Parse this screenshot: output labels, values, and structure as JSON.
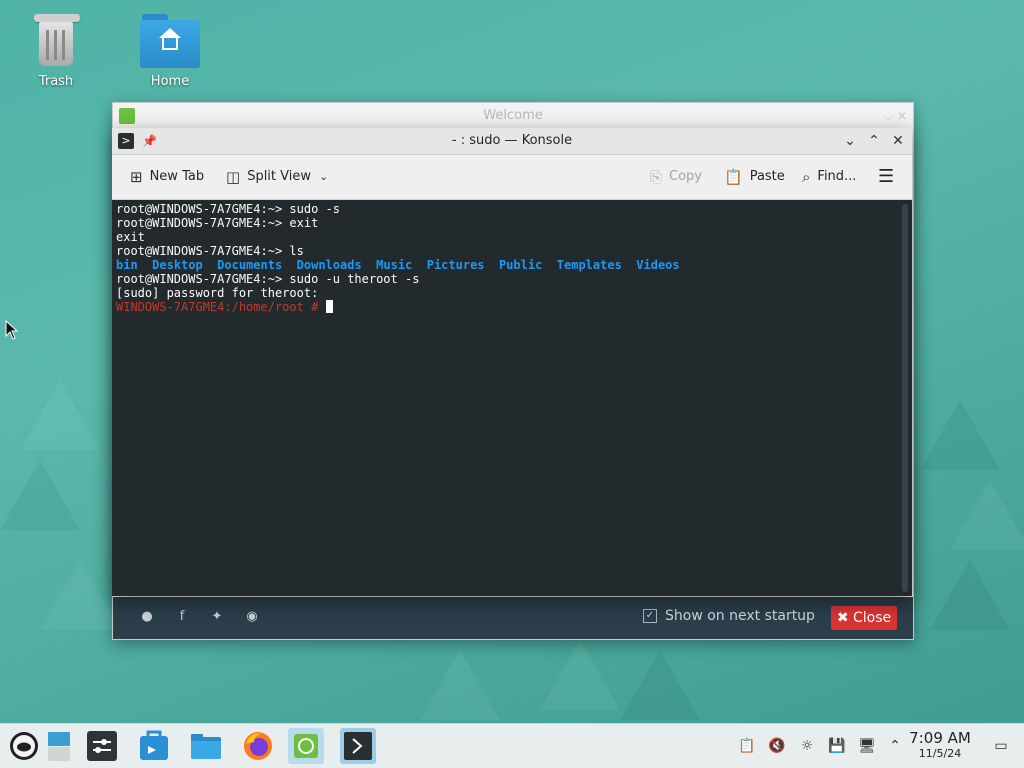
{
  "desktop": {
    "icons": [
      {
        "label": "Trash",
        "icon": "trash-icon"
      },
      {
        "label": "Home",
        "icon": "home-folder-icon"
      }
    ]
  },
  "welcome_window": {
    "title": "Welcome",
    "footer": {
      "social": [
        "reddit-icon",
        "facebook-icon",
        "twitter-icon",
        "mastodon-icon"
      ],
      "show_on_startup_label": "Show on next startup",
      "show_on_startup_checked": true,
      "close_label": "✖ Close",
      "close_color": "#d93434"
    }
  },
  "konsole": {
    "title": "- : sudo — Konsole",
    "toolbar": {
      "new_tab": "New Tab",
      "split_view": "Split View",
      "copy": "Copy",
      "paste": "Paste",
      "find": "Find..."
    },
    "lines": [
      {
        "text": "root@WINDOWS-7A7GME4:~> sudo -s"
      },
      {
        "text": "root@WINDOWS-7A7GME4:~> exit"
      },
      {
        "text": "exit"
      },
      {
        "text": "root@WINDOWS-7A7GME4:~> ls"
      },
      {
        "dirs": [
          "bin",
          "Desktop",
          "Documents",
          "Downloads",
          "Music",
          "Pictures",
          "Public",
          "Templates",
          "Videos"
        ]
      },
      {
        "text": "root@WINDOWS-7A7GME4:~> sudo -u theroot -s"
      },
      {
        "text": "[sudo] password for theroot:"
      },
      {
        "prompt": "WINDOWS-7A7GME4:/home/root # "
      }
    ],
    "dir_color": "#1d99f3",
    "prompt_color": "#c0392b"
  },
  "taskbar": {
    "apps": [
      "opensuse-menu-icon",
      "pager-icon",
      "settings-icon",
      "discover-icon",
      "files-icon",
      "firefox-icon",
      "welcome-app-icon",
      "konsole-icon"
    ],
    "tray": [
      "clipboard-icon",
      "volume-muted-icon",
      "brightness-icon",
      "disk-icon",
      "network-icon",
      "expand-tray-icon"
    ],
    "time": "7:09 AM",
    "date": "11/5/24",
    "show_desktop": "show-desktop-icon"
  }
}
